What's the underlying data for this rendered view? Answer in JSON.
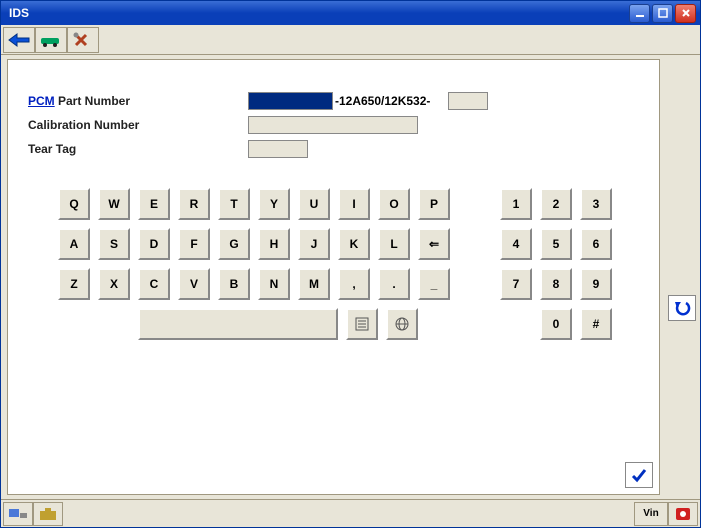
{
  "window": {
    "title": "IDS"
  },
  "toolbar": {
    "back_icon": "back",
    "car_icon": "car",
    "tools_icon": "tools"
  },
  "form": {
    "pcm_link": "PCM",
    "pcm_label": " Part Number",
    "pcm_value_text": "-12A650/12K532-",
    "cal_label": "Calibration Number",
    "tear_label": "Tear Tag"
  },
  "keyboard": {
    "rows": [
      [
        "Q",
        "W",
        "E",
        "R",
        "T",
        "Y",
        "U",
        "I",
        "O",
        "P"
      ],
      [
        "A",
        "S",
        "D",
        "F",
        "G",
        "H",
        "J",
        "K",
        "L",
        "⇐"
      ],
      [
        "Z",
        "X",
        "C",
        "V",
        "B",
        "N",
        "M",
        ",",
        ".",
        "_"
      ]
    ],
    "numpad": [
      [
        "1",
        "2",
        "3"
      ],
      [
        "4",
        "5",
        "6"
      ],
      [
        "7",
        "8",
        "9"
      ],
      [
        "",
        "0",
        "#"
      ]
    ]
  },
  "side": {
    "undo": "↶"
  },
  "bottom": {
    "vin": "Vin"
  }
}
